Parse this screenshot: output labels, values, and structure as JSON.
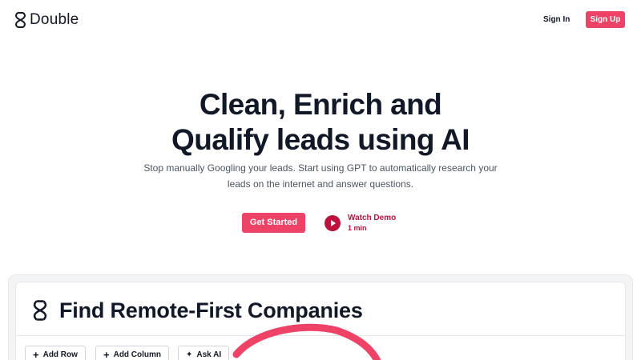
{
  "header": {
    "brand": "Double",
    "signin_label": "Sign In",
    "signup_label": "Sign Up"
  },
  "hero": {
    "title_line1": "Clean, Enrich and",
    "title_line2": "Qualify leads using AI",
    "subtitle": "Stop manually Googling your leads. Start using GPT to automatically research your leads on the internet and answer questions.",
    "cta_label": "Get Started",
    "demo_label": "Watch Demo",
    "demo_duration": "1 min"
  },
  "preview": {
    "title": "Find Remote-First Companies",
    "toolbar": {
      "add_row": "Add Row",
      "add_column": "Add Column",
      "ask_ai": "Ask AI"
    }
  },
  "colors": {
    "accent": "#ee4266",
    "accent_dark": "#be123c",
    "text": "#111827",
    "muted": "#4b5563"
  },
  "icons": {
    "logo": "double-loop-logo-icon",
    "play": "play-icon",
    "plus": "plus-icon",
    "wand": "magic-wand-icon"
  }
}
